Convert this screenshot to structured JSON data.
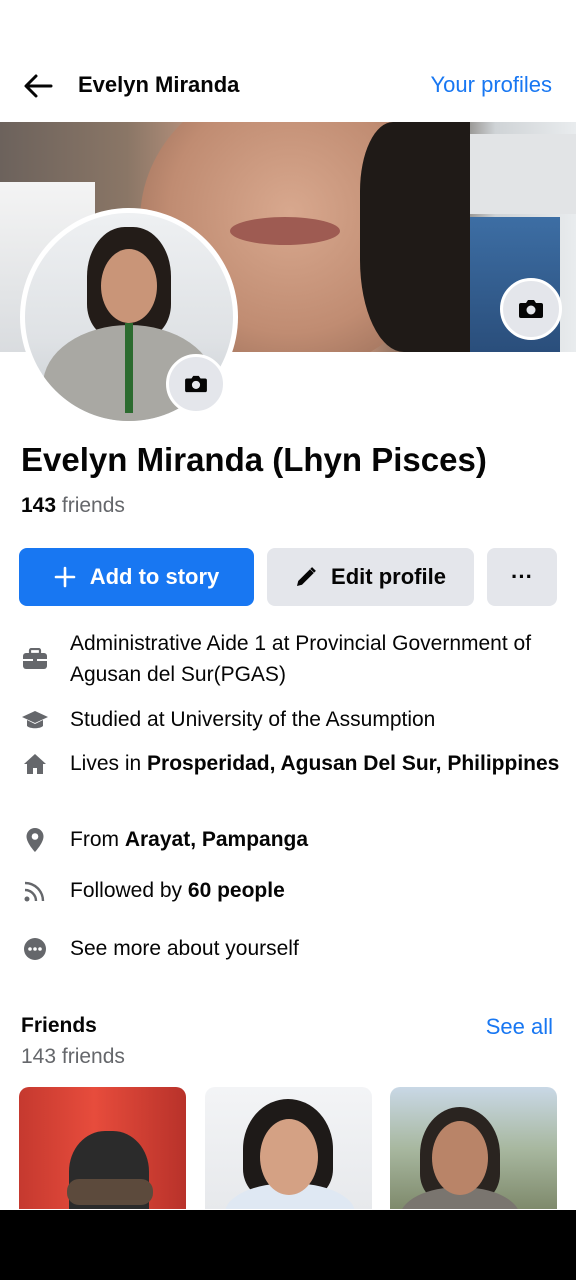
{
  "header": {
    "title": "Evelyn Miranda",
    "your_profiles": "Your profiles",
    "back_icon": "arrow-left-icon"
  },
  "profile": {
    "name": "Evelyn Miranda (Lhyn Pisces)",
    "friends_count": "143",
    "friends_label": " friends"
  },
  "actions": {
    "add_story": "Add to story",
    "edit_profile": "Edit profile",
    "more": "···"
  },
  "details": {
    "work": "Administrative Aide 1 at Provincial Government of Agusan del Sur(PGAS)",
    "education": "Studied at University of the Assumption",
    "lives_prefix": "Lives in ",
    "lives_place": "Prosperidad, Agusan Del Sur, Philippines",
    "from_prefix": "From ",
    "from_place": "Arayat, Pampanga",
    "followed_prefix": "Followed by ",
    "followed_count": "60 people",
    "see_more": "See more about yourself"
  },
  "friends": {
    "title": "Friends",
    "see_all": "See all",
    "subtitle": "143 friends"
  },
  "colors": {
    "accent": "#1877f2",
    "secondary_text": "#65676b",
    "button_gray": "#e4e6eb"
  }
}
